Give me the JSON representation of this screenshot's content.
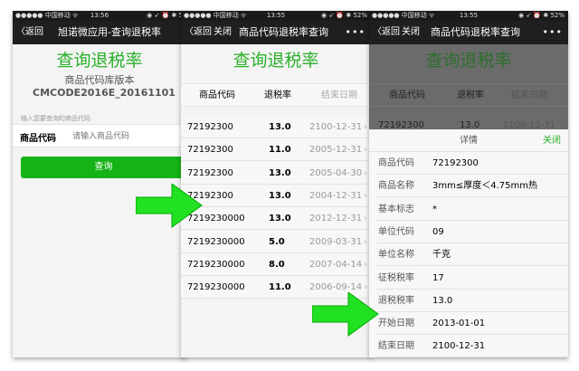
{
  "colors": {
    "accent": "#2ab02a",
    "arrow": "#22e022",
    "navbar": "#1f1f1f"
  },
  "screen1": {
    "status": {
      "carrier": "●●●●● 中国移动 ᯤ",
      "time": "13:56",
      "right": "◉ ➶ ⏰ ✱ 5"
    },
    "nav": {
      "back": "〈返回",
      "title": "旭诺微应用-查询退税率"
    },
    "heading": "查询退税率",
    "version_label": "商品代码库版本",
    "version": "CMCODE2016E_20161101",
    "hint": "输入您要查询的商品代码",
    "field_label": "商品代码",
    "field_placeholder": "请输入商品代码",
    "query_button": "查询"
  },
  "screen2": {
    "status": {
      "carrier": "●●●●● 中国移动 ᯤ",
      "time": "13:55",
      "right": "◉ ➶ ⏰ ✱ 52%"
    },
    "nav": {
      "back": "〈返回",
      "close": "关闭",
      "title": "商品代码退税率查询",
      "more": "•••"
    },
    "heading": "查询退税率",
    "columns": [
      "商品代码",
      "退税率",
      "结束日期"
    ],
    "rows": [
      [
        "72192300",
        "13.0",
        "2100-12-31"
      ],
      [
        "72192300",
        "11.0",
        "2005-12-31"
      ],
      [
        "72192300",
        "13.0",
        "2005-04-30"
      ],
      [
        "72192300",
        "13.0",
        "2004-12-31"
      ],
      [
        "7219230000",
        "13.0",
        "2012-12-31"
      ],
      [
        "7219230000",
        "5.0",
        "2009-03-31"
      ],
      [
        "7219230000",
        "8.0",
        "2007-04-14"
      ],
      [
        "7219230000",
        "11.0",
        "2006-09-14"
      ]
    ]
  },
  "screen3": {
    "status": {
      "carrier": "●●●●● 中国移动 ᯤ",
      "time": "13:55",
      "right": "◉ ➶ ⏰ ✱ 52%"
    },
    "nav": {
      "back": "〈返回",
      "close": "关闭",
      "title": "商品代码退税率查询",
      "more": "•••"
    },
    "heading": "查询退税率",
    "columns": [
      "商品代码",
      "退税率",
      "结束日期"
    ],
    "peek_row": [
      "72192300",
      "13.0",
      "2100-12-31"
    ],
    "panel": {
      "title": "详情",
      "close": "关闭",
      "fields": [
        [
          "商品代码",
          "72192300"
        ],
        [
          "商品名称",
          "3mm≤厚度＜4.75mm热"
        ],
        [
          "基本标志",
          "*"
        ],
        [
          "单位代码",
          "09"
        ],
        [
          "单位名称",
          "千克"
        ],
        [
          "征税税率",
          "17"
        ],
        [
          "退税税率",
          "13.0"
        ],
        [
          "开始日期",
          "2013-01-01"
        ],
        [
          "结束日期",
          "2100-12-31"
        ]
      ]
    }
  }
}
